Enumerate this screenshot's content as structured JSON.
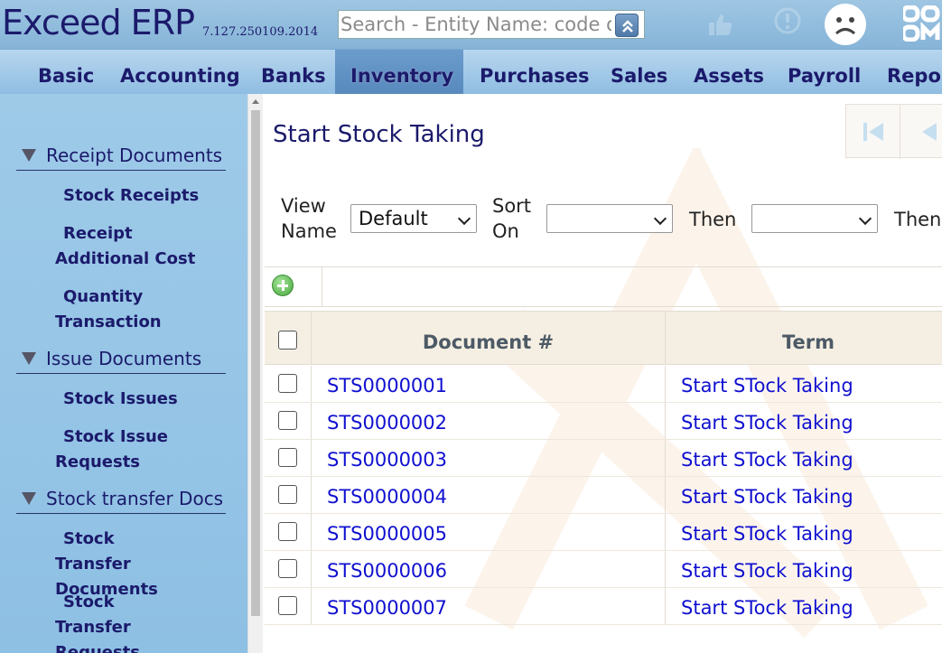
{
  "app": {
    "title": "Exceed ERP",
    "version": "7.127.250109.2014"
  },
  "search": {
    "placeholder": "Search - Entity Name: code or"
  },
  "nav": {
    "items": [
      {
        "label": "Basic"
      },
      {
        "label": "Accounting"
      },
      {
        "label": "Banks"
      },
      {
        "label": "Inventory",
        "active": true
      },
      {
        "label": "Purchases"
      },
      {
        "label": "Sales"
      },
      {
        "label": "Assets"
      },
      {
        "label": "Payroll"
      },
      {
        "label": "Repor"
      }
    ]
  },
  "sidebar": {
    "sections": [
      {
        "title": "Receipt Documents",
        "links": [
          "Stock Receipts",
          "Receipt Additional Cost",
          "Quantity Transaction"
        ]
      },
      {
        "title": "Issue Documents",
        "links": [
          "Stock Issues",
          "Stock Issue Requests"
        ]
      },
      {
        "title": "Stock transfer Docs",
        "links": [
          "Stock Transfer Documents",
          "Stock Transfer Requests"
        ]
      }
    ]
  },
  "page": {
    "title": "Start Stock Taking"
  },
  "filters": {
    "view_name_label": "View Name",
    "view_name_value": "Default",
    "sort_on_label": "Sort On",
    "sort_on_value": "",
    "then_label_1": "Then",
    "then_value_1": "",
    "then_label_2": "Then"
  },
  "grid": {
    "columns": [
      "Document #",
      "Term"
    ],
    "rows": [
      {
        "doc": "STS0000001",
        "term": "Start STock Taking"
      },
      {
        "doc": "STS0000002",
        "term": "Start STock Taking"
      },
      {
        "doc": "STS0000003",
        "term": "Start STock Taking"
      },
      {
        "doc": "STS0000004",
        "term": "Start STock Taking"
      },
      {
        "doc": "STS0000005",
        "term": "Start STock Taking"
      },
      {
        "doc": "STS0000006",
        "term": "Start STock Taking"
      },
      {
        "doc": "STS0000007",
        "term": "Start STock Taking"
      }
    ]
  },
  "icons": {
    "search_button": "chevrons-up-icon",
    "like": "thumbs-up-icon",
    "alert": "alert-circle-icon",
    "feedback": "sad-face-icon",
    "qr": "qr-code-icon",
    "add": "add-circle-icon"
  },
  "colors": {
    "brand": "#1b1a6b",
    "nav": "#9ecae8",
    "link": "#1010d0",
    "add": "#46a53c"
  }
}
